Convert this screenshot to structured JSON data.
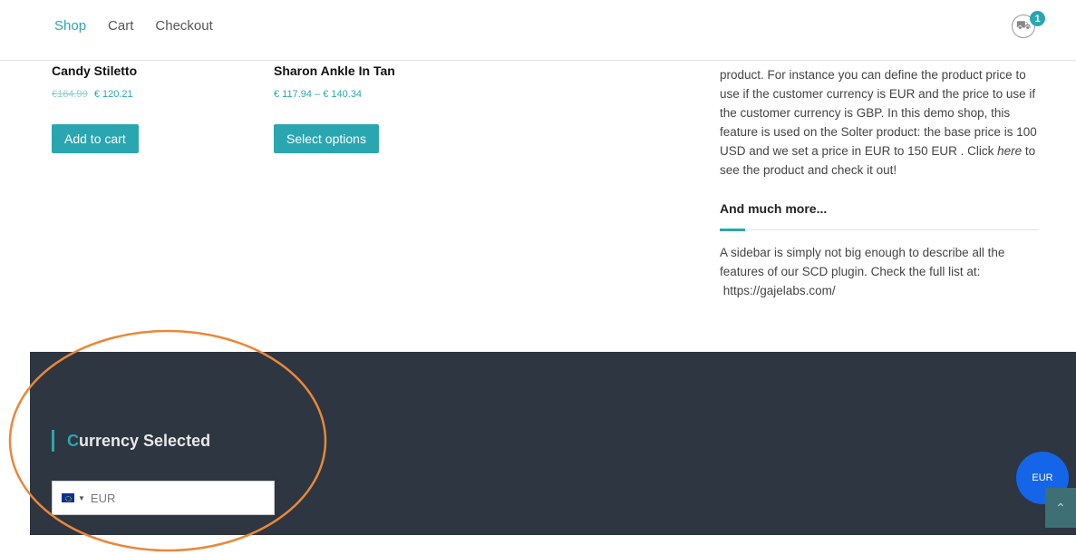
{
  "nav": {
    "items": [
      "Shop",
      "Cart",
      "Checkout"
    ]
  },
  "cart": {
    "count": "1",
    "icon": "cart-icon"
  },
  "products": [
    {
      "name": "Candy Stiletto",
      "old_price": "€164.99",
      "price": "€ 120.21",
      "button": "Add to cart"
    },
    {
      "name": "Sharon Ankle In Tan",
      "price_range": "€ 117.94 – € 140.34",
      "button": "Select options"
    }
  ],
  "sidebar": {
    "paragraph1_a": "product. For instance you can define the product price to use if the customer currency is EUR and the price to use if the customer currency is GBP.  In this demo shop, this feature is used on the Solter product: the base price is 100 USD and we set a price in EUR to 150 EUR . Click ",
    "paragraph1_link": "here",
    "paragraph1_b": " to see the product and check it out!",
    "heading": "And much more...",
    "paragraph2": "A sidebar is simply not big enough to describe all the features of our SCD plugin. Check the full list at:",
    "link": "https://gajelabs.com/"
  },
  "footer": {
    "title_first": "C",
    "title_rest": "urrency Selected",
    "currency_value": "EUR"
  },
  "floating": {
    "currency": "EUR"
  },
  "colors": {
    "accent": "#2aa6b1",
    "footer_bg": "#2d3641",
    "bubble": "#1565e8",
    "annotation": "#e8883a"
  }
}
